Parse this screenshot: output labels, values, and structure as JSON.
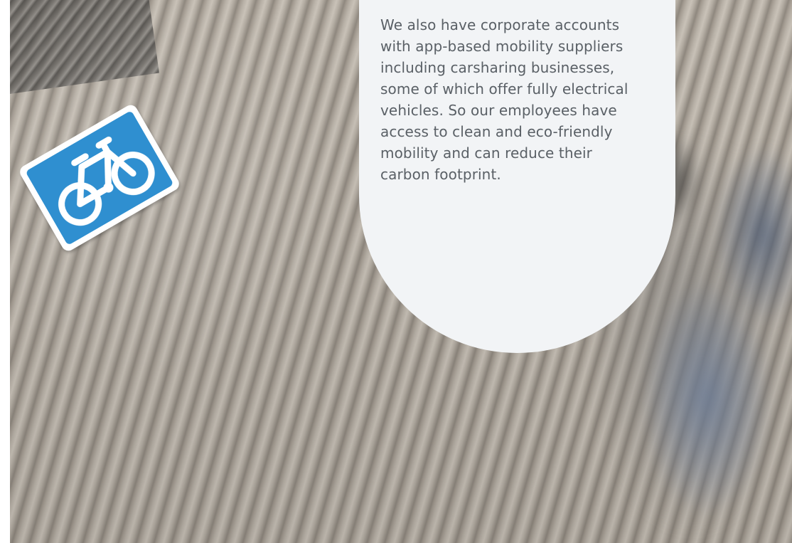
{
  "body_text_lines": [
    "We also have corporate accounts",
    "with app-based mobility suppliers",
    "including carsharing businesses,",
    "some of which offer fully electrical",
    "vehicles. So our employees have",
    "access to clean and eco-friendly",
    "mobility and can reduce their",
    "carbon footprint."
  ],
  "colors": {
    "bubble_background": "#f2f4f6",
    "text": "#5a6066",
    "sign_blue": "#2f8fd0",
    "sign_border": "#ffffff"
  },
  "icons": {
    "sign": "bicycle-sign-icon"
  }
}
